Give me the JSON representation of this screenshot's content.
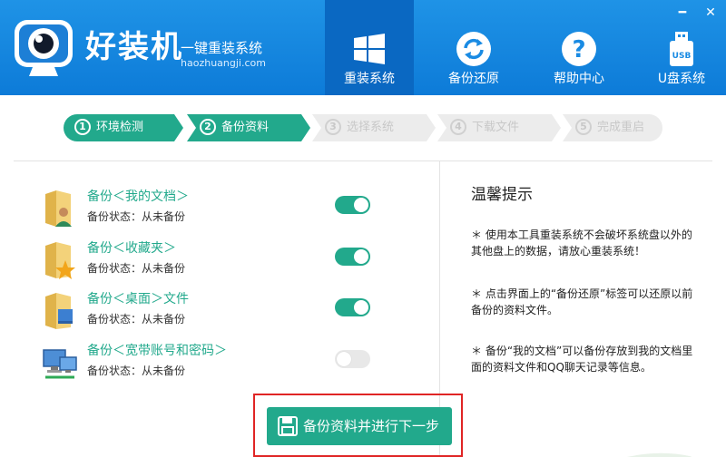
{
  "header": {
    "brand_name": "好装机",
    "slogan": "一键重装系统",
    "url_text": "haozhuangji.com",
    "minimize_glyph": "━",
    "close_glyph": "✕",
    "tabs": [
      {
        "label": "重装系统",
        "icon": "windows-icon",
        "active": true
      },
      {
        "label": "备份还原",
        "icon": "sync-icon",
        "active": false
      },
      {
        "label": "帮助中心",
        "icon": "help-icon",
        "active": false
      },
      {
        "label": "U盘系统",
        "icon": "usb-icon",
        "active": false
      }
    ]
  },
  "steps": [
    {
      "num": "1",
      "label": "环境检测",
      "state": "done"
    },
    {
      "num": "2",
      "label": "备份资料",
      "state": "current"
    },
    {
      "num": "3",
      "label": "选择系统",
      "state": "pending"
    },
    {
      "num": "4",
      "label": "下载文件",
      "state": "pending"
    },
    {
      "num": "5",
      "label": "完成重启",
      "state": "pending"
    }
  ],
  "backup_items": [
    {
      "title": "备份＜我的文档＞",
      "status": "备份状态：从未备份",
      "enabled": true,
      "icon": "documents-folder-icon"
    },
    {
      "title": "备份＜收藏夹＞",
      "status": "备份状态：从未备份",
      "enabled": true,
      "icon": "favorites-folder-icon"
    },
    {
      "title": "备份＜桌面＞文件",
      "status": "备份状态：从未备份",
      "enabled": true,
      "icon": "desktop-folder-icon"
    },
    {
      "title": "备份＜宽带账号和密码＞",
      "status": "备份状态：从未备份",
      "enabled": false,
      "icon": "network-computer-icon"
    }
  ],
  "tips": {
    "title": "温馨提示",
    "items": [
      "＊ 使用本工具重装系统不会破坏系统盘以外的其他盘上的数据，请放心重装系统！",
      "＊ 点击界面上的“备份还原”标签可以还原以前备份的资料文件。",
      "＊ 备份“我的文档”可以备份存放到我的文档里面的资料文件和QQ聊天记录等信息。"
    ]
  },
  "next_button": {
    "label": "备份资料并进行下一步",
    "icon": "save-icon"
  },
  "colors": {
    "header_blue": "#1a8be3",
    "active_tab": "#0a68c2",
    "accent_green": "#22a98c",
    "highlight_red": "#e02525"
  }
}
